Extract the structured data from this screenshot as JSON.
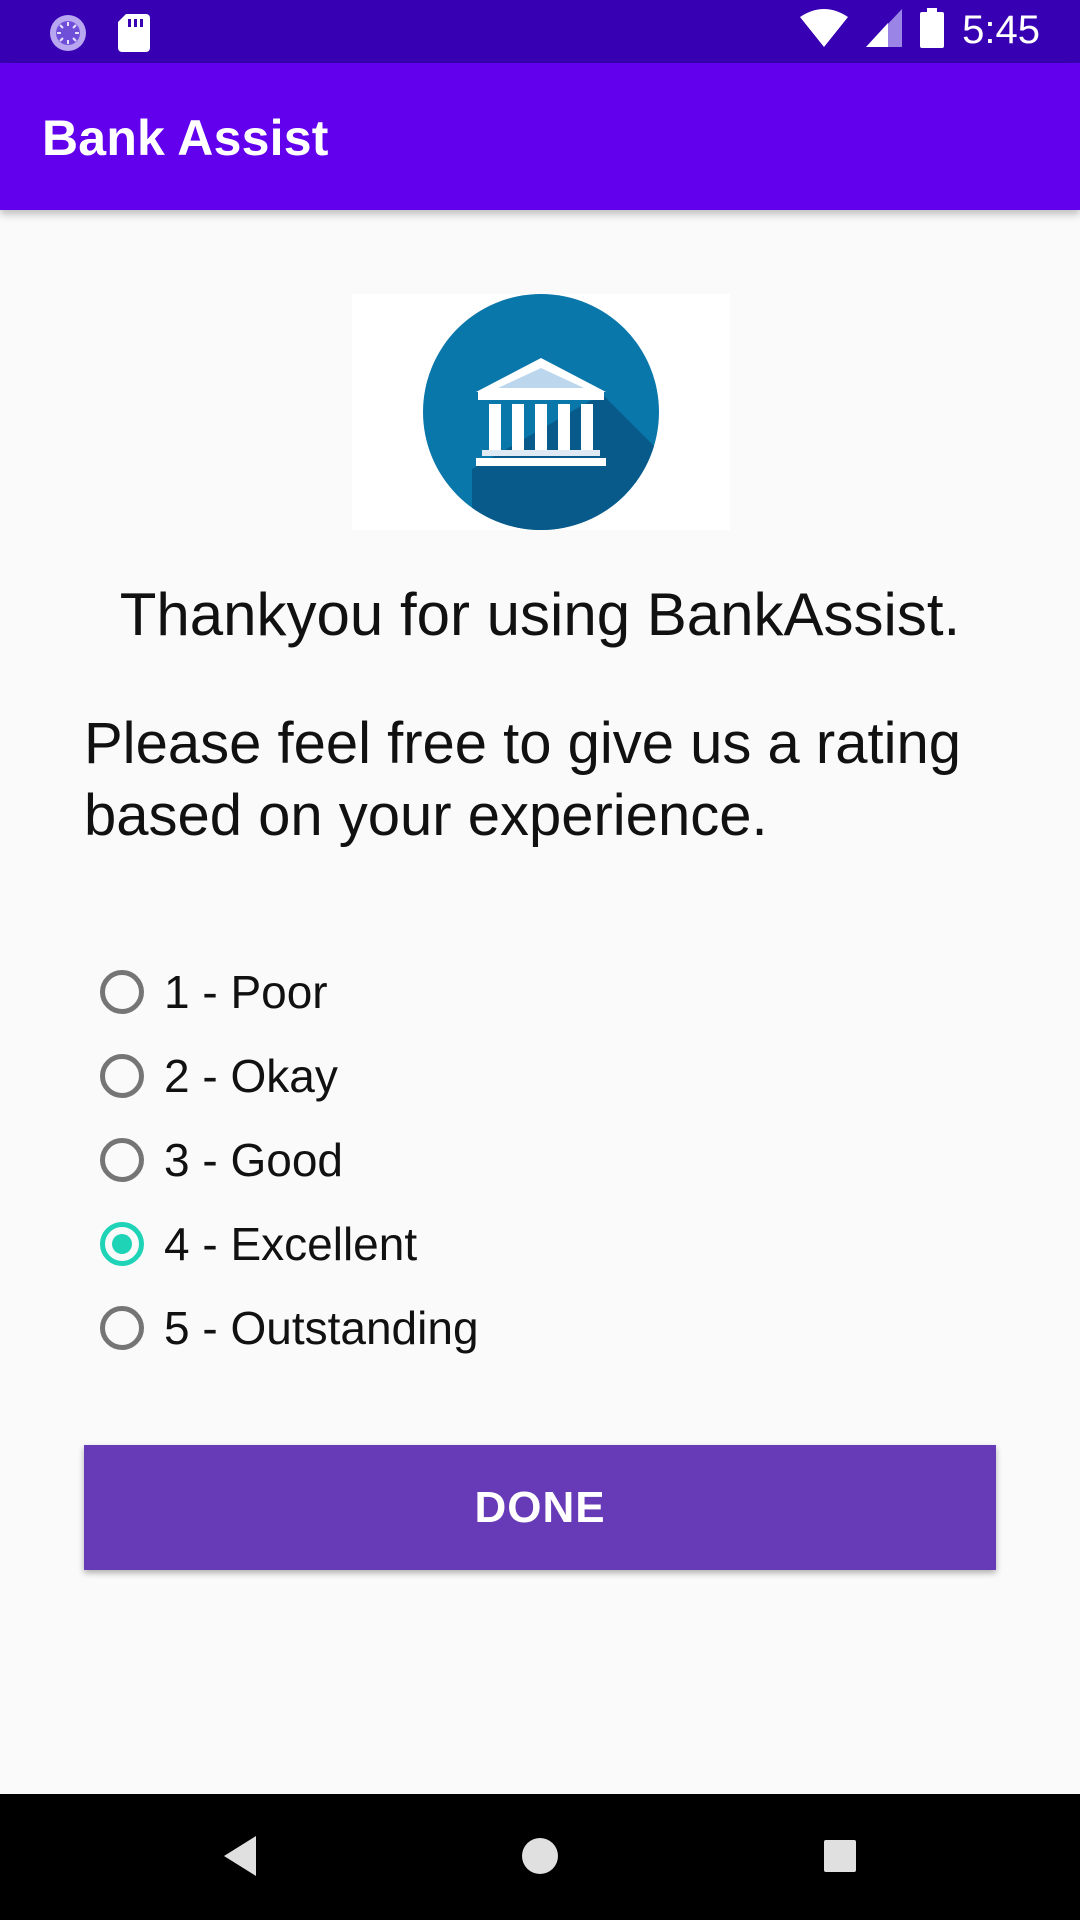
{
  "status_bar": {
    "time": "5:45",
    "icons": [
      "sync-icon",
      "sd-card-icon",
      "wifi-icon",
      "signal-icon",
      "battery-icon"
    ]
  },
  "app_bar": {
    "title": "Bank Assist"
  },
  "logo": {
    "icon": "bank-icon",
    "color": "#0a77ab"
  },
  "thanks_text": "Thankyou for using BankAssist.",
  "prompt_text": "Please feel free to give us a rating based on your experience.",
  "rating_options": [
    {
      "label": "1 - Poor",
      "checked": false
    },
    {
      "label": "2 - Okay",
      "checked": false
    },
    {
      "label": "3 - Good",
      "checked": false
    },
    {
      "label": "4 - Excellent",
      "checked": true
    },
    {
      "label": "5 - Outstanding",
      "checked": false
    }
  ],
  "done_button": {
    "label": "DONE"
  },
  "colors": {
    "status_bar": "#3700b3",
    "app_bar": "#6200ee",
    "button": "#673ab7",
    "radio_checked": "#1fd3b6"
  },
  "nav_bar": {
    "icons": [
      "back-icon",
      "home-icon",
      "recents-icon"
    ]
  }
}
